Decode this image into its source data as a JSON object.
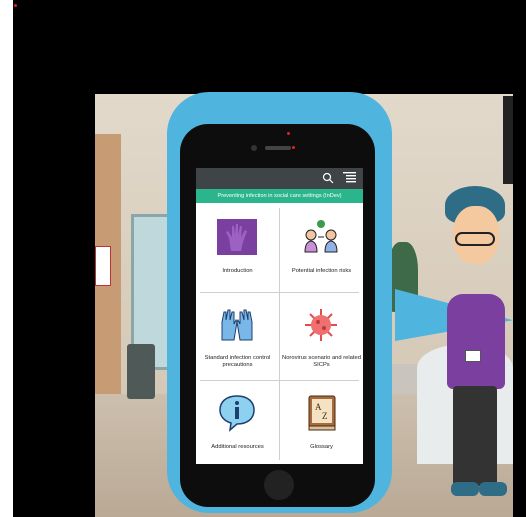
{
  "app": {
    "banner_title": "Preventing infection in social care settings (InDev)"
  },
  "topbar": {
    "search_icon": "search-icon",
    "menu_icon": "hamburger-menu-icon"
  },
  "tiles": [
    {
      "label": "Introduction",
      "icon": "hand-icon"
    },
    {
      "label": "Potential infection risks",
      "icon": "people-germ-icon"
    },
    {
      "label": "Standard infection control precautions",
      "icon": "gloves-icon"
    },
    {
      "label": "Norovirus scenario and related SICPs",
      "icon": "virus-icon"
    },
    {
      "label": "Additional resources",
      "icon": "info-bubble-icon"
    },
    {
      "label": "Glossary",
      "icon": "dictionary-icon"
    }
  ],
  "colors": {
    "banner": "#2bb58c",
    "topbar": "#3f4447",
    "phone_case": "#4fb4de",
    "hand_tile": "#7b3fa0"
  }
}
